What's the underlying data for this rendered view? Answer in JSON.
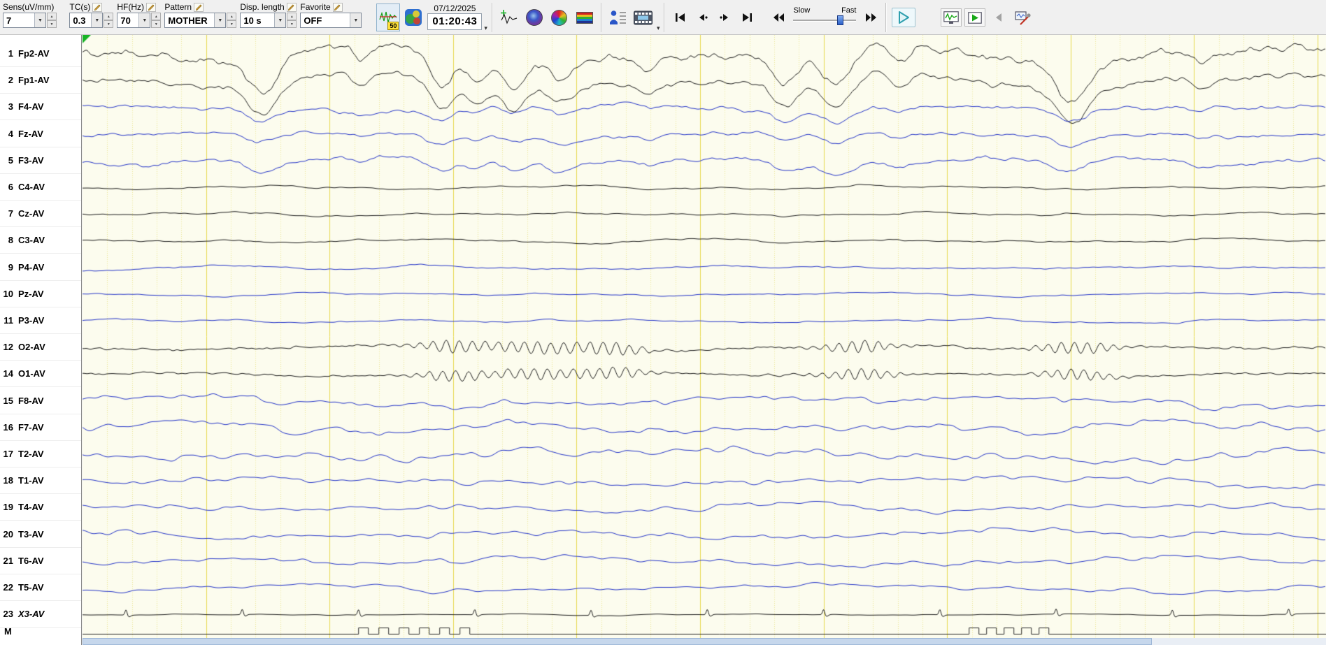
{
  "toolbar": {
    "fields": [
      {
        "label": "Sens(uV/mm)",
        "value": "7",
        "pencil": false,
        "spinner": true
      },
      {
        "label": "TC(s)",
        "value": "0.3",
        "pencil": true,
        "spinner": true
      },
      {
        "label": "HF(Hz)",
        "value": "70",
        "pencil": true,
        "spinner": true
      },
      {
        "label": "Pattern",
        "value": "MOTHER",
        "pencil": true,
        "spinner": true
      },
      {
        "label": "Disp. length",
        "value": "10 s",
        "pencil": true,
        "spinner": true
      },
      {
        "label": "Favorite",
        "value": "OFF",
        "pencil": true,
        "spinner": false
      }
    ],
    "filter_badge": "50",
    "date": "07/12/2025",
    "time": "01:20:43",
    "speed": {
      "slow_label": "Slow",
      "fast_label": "Fast",
      "position": 0.78
    }
  },
  "sidebar": {
    "marker_label": "M",
    "channels": [
      {
        "num": "1",
        "label": "Fp2-AV",
        "color": "#1a1a1a",
        "kind": "frontal_large",
        "amp": 30
      },
      {
        "num": "2",
        "label": "Fp1-AV",
        "color": "#1a1a1a",
        "kind": "frontal_large",
        "amp": 26
      },
      {
        "num": "3",
        "label": "F4-AV",
        "color": "#2434c8",
        "kind": "frontal_med",
        "amp": 13
      },
      {
        "num": "4",
        "label": "Fz-AV",
        "color": "#2434c8",
        "kind": "frontal_med",
        "amp": 11
      },
      {
        "num": "5",
        "label": "F3-AV",
        "color": "#2434c8",
        "kind": "frontal_med",
        "amp": 12
      },
      {
        "num": "6",
        "label": "C4-AV",
        "color": "#1a1a1a",
        "kind": "small",
        "amp": 4.5
      },
      {
        "num": "7",
        "label": "Cz-AV",
        "color": "#1a1a1a",
        "kind": "small",
        "amp": 4
      },
      {
        "num": "8",
        "label": "C3-AV",
        "color": "#1a1a1a",
        "kind": "small",
        "amp": 4.5
      },
      {
        "num": "9",
        "label": "P4-AV",
        "color": "#2434c8",
        "kind": "small",
        "amp": 5
      },
      {
        "num": "10",
        "label": "Pz-AV",
        "color": "#2434c8",
        "kind": "small",
        "amp": 4.5
      },
      {
        "num": "11",
        "label": "P3-AV",
        "color": "#2434c8",
        "kind": "small",
        "amp": 5
      },
      {
        "num": "12",
        "label": "O2-AV",
        "color": "#1a1a1a",
        "kind": "occipital",
        "amp": 9
      },
      {
        "num": "14",
        "label": "O1-AV",
        "color": "#1a1a1a",
        "kind": "occipital",
        "amp": 8
      },
      {
        "num": "15",
        "label": "F8-AV",
        "color": "#2434c8",
        "kind": "temporal",
        "amp": 12
      },
      {
        "num": "16",
        "label": "F7-AV",
        "color": "#2434c8",
        "kind": "temporal",
        "amp": 13
      },
      {
        "num": "17",
        "label": "T2-AV",
        "color": "#2434c8",
        "kind": "temporal",
        "amp": 13
      },
      {
        "num": "18",
        "label": "T1-AV",
        "color": "#2434c8",
        "kind": "temporal",
        "amp": 12
      },
      {
        "num": "19",
        "label": "T4-AV",
        "color": "#2434c8",
        "kind": "temporal",
        "amp": 10
      },
      {
        "num": "20",
        "label": "T3-AV",
        "color": "#2434c8",
        "kind": "temporal",
        "amp": 10
      },
      {
        "num": "21",
        "label": "T6-AV",
        "color": "#2434c8",
        "kind": "temporal",
        "amp": 9
      },
      {
        "num": "22",
        "label": "T5-AV",
        "color": "#2434c8",
        "kind": "temporal",
        "amp": 9
      },
      {
        "num": "23",
        "label": "X3-AV",
        "color": "#1a1a1a",
        "kind": "aux",
        "amp": 4,
        "italic": true
      }
    ]
  },
  "trace_area": {
    "background": "#fcfcee",
    "grid_major_color": "#e7d94e",
    "grid_minor_color": "#ede694",
    "trace_blue": "#2434c8",
    "trace_black": "#1a1a1a",
    "seconds": 10,
    "minor_per_major": 5
  }
}
